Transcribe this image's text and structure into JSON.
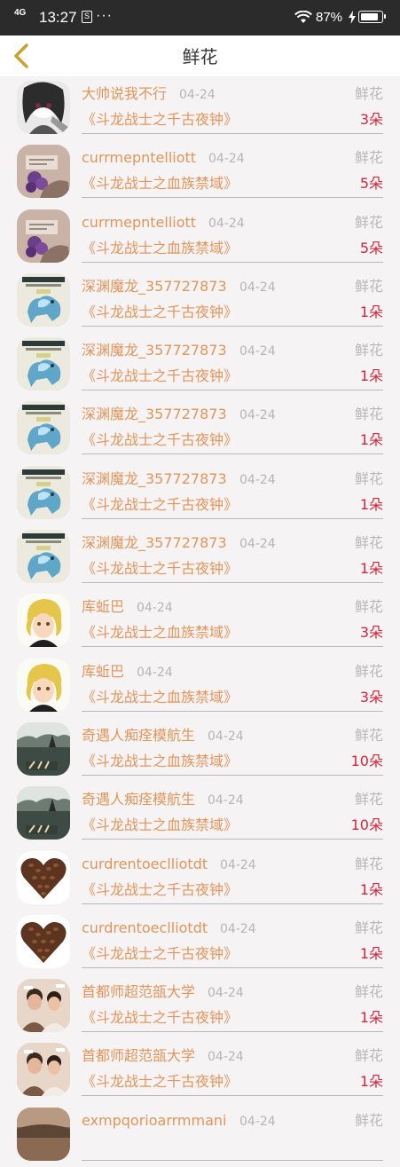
{
  "status_bar": {
    "signal": "4G",
    "time": "13:27",
    "sim": "S",
    "dots": "···",
    "battery": "87%",
    "battery_level": 0.87
  },
  "header": {
    "back_icon": "chevron-left-icon",
    "title": "鲜花"
  },
  "gift_label": "鲜花",
  "items": [
    {
      "name": "大帅说我不行",
      "date": "04-24",
      "book": "《斗龙战士之千古夜钟》",
      "count": "3朵",
      "avatar": "anime-girl"
    },
    {
      "name": "currmepntelliott",
      "date": "04-24",
      "book": "《斗龙战士之血族禁域》",
      "count": "5朵",
      "avatar": "purple-flower"
    },
    {
      "name": "currmepntelliott",
      "date": "04-24",
      "book": "《斗龙战士之血族禁域》",
      "count": "5朵",
      "avatar": "purple-flower"
    },
    {
      "name": "深渊魔龙_357727873",
      "date": "04-24",
      "book": "《斗龙战士之千古夜钟》",
      "count": "1朵",
      "avatar": "blue-wolf"
    },
    {
      "name": "深渊魔龙_357727873",
      "date": "04-24",
      "book": "《斗龙战士之千古夜钟》",
      "count": "1朵",
      "avatar": "blue-wolf"
    },
    {
      "name": "深渊魔龙_357727873",
      "date": "04-24",
      "book": "《斗龙战士之千古夜钟》",
      "count": "1朵",
      "avatar": "blue-wolf"
    },
    {
      "name": "深渊魔龙_357727873",
      "date": "04-24",
      "book": "《斗龙战士之千古夜钟》",
      "count": "1朵",
      "avatar": "blue-wolf"
    },
    {
      "name": "深渊魔龙_357727873",
      "date": "04-24",
      "book": "《斗龙战士之千古夜钟》",
      "count": "1朵",
      "avatar": "blue-wolf"
    },
    {
      "name": "库蚯巴",
      "date": "04-24",
      "book": "《斗龙战士之血族禁域》",
      "count": "3朵",
      "avatar": "blond-boy"
    },
    {
      "name": "库蚯巴",
      "date": "04-24",
      "book": "《斗龙战士之血族禁域》",
      "count": "3朵",
      "avatar": "blond-boy"
    },
    {
      "name": "奇遇人痴痊模航生",
      "date": "04-24",
      "book": "《斗龙战士之血族禁域》",
      "count": "10朵",
      "avatar": "lake-scene"
    },
    {
      "name": "奇遇人痴痊模航生",
      "date": "04-24",
      "book": "《斗龙战士之血族禁域》",
      "count": "10朵",
      "avatar": "lake-scene"
    },
    {
      "name": "curdrentoeclliotdt",
      "date": "04-24",
      "book": "《斗龙战士之千古夜钟》",
      "count": "1朵",
      "avatar": "coffee-heart"
    },
    {
      "name": "curdrentoeclliotdt",
      "date": "04-24",
      "book": "《斗龙战士之千古夜钟》",
      "count": "1朵",
      "avatar": "coffee-heart"
    },
    {
      "name": "首都师超范瓿大学",
      "date": "04-24",
      "book": "《斗龙战士之千古夜钟》",
      "count": "1朵",
      "avatar": "couple-photo"
    },
    {
      "name": "首都师超范瓿大学",
      "date": "04-24",
      "book": "《斗龙战士之千古夜钟》",
      "count": "1朵",
      "avatar": "couple-photo"
    },
    {
      "name": "exmpqorioarrmmani",
      "date": "04-24",
      "book": "",
      "count": "",
      "avatar": "landscape"
    }
  ]
}
